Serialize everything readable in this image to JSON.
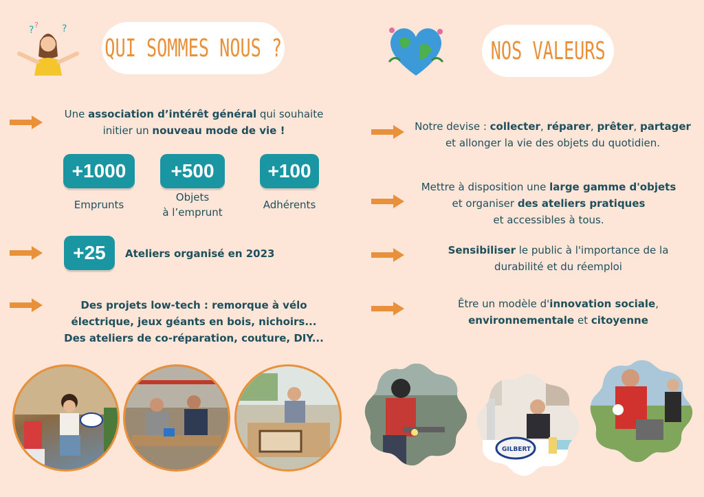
{
  "left": {
    "title": "QUI SOMMES NOUS ?",
    "intro": {
      "t1": "Une ",
      "b1": "association d’intérêt général",
      "t2": " qui souhaite",
      "t3": "initier un ",
      "b2": "nouveau mode de vie !"
    },
    "stats": [
      {
        "value": "+1000",
        "label1": "Emprunts",
        "label2": ""
      },
      {
        "value": "+500",
        "label1": "Objets",
        "label2": "à l’emprunt"
      },
      {
        "value": "+100",
        "label1": "Adhérents",
        "label2": ""
      }
    ],
    "workshops": {
      "value": "+25",
      "label": "Ateliers organisé en 2023"
    },
    "projects": [
      "Des projets low-tech : remorque à vélo",
      "électrique, jeux géants en bois, nichoirs...",
      "Des ateliers de co-réparation, couture, DIY..."
    ]
  },
  "right": {
    "title": "NOS VALEURS",
    "v1": {
      "t1": "Notre devise : ",
      "b1": "collecter",
      "t2": ", ",
      "b2": "réparer",
      "t3": ", ",
      "b3": "prêter",
      "t4": ", ",
      "b4": "partager",
      "line2": "et allonger la vie des objets du quotidien."
    },
    "v2": {
      "t1": "Mettre à disposition une ",
      "b1": "large gamme d'objets",
      "t2": "et organiser ",
      "b2": "des ateliers pratiques",
      "line3": "et accessibles à tous."
    },
    "v3": {
      "b1": "Sensibiliser",
      "t1": " le public à l'importance de la",
      "line2": "durabilité et du réemploi"
    },
    "v4": {
      "t1": "Être un modèle d'",
      "b1": "innovation sociale",
      "t2": ",",
      "b2": "environnementale",
      "t3": " et ",
      "b3": "citoyenne"
    }
  },
  "photo_ball_text": "GILBERT",
  "colors": {
    "background": "#fde6d7",
    "accent": "#e8913a",
    "teal": "#1a96a3",
    "text": "#1f4e5c"
  }
}
